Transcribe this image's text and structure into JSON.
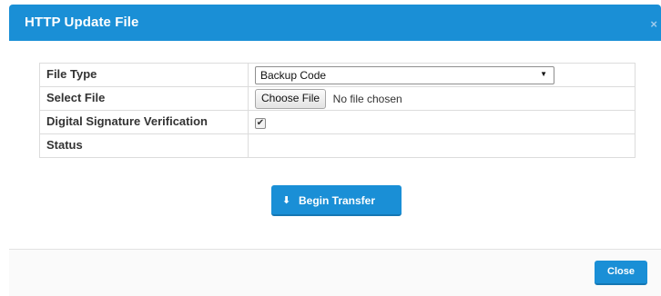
{
  "modal": {
    "title": "HTTP Update File",
    "close_glyph": "×"
  },
  "form": {
    "rows": [
      {
        "label": "File Type"
      },
      {
        "label": "Select File"
      },
      {
        "label": "Digital Signature Verification"
      },
      {
        "label": "Status"
      }
    ],
    "file_type": {
      "selected": "Backup Code",
      "arrow": "▼"
    },
    "select_file": {
      "button_label": "Choose File",
      "status": "No file chosen"
    },
    "signature_verification": {
      "checked": true,
      "check_glyph": "✔"
    },
    "status_value": ""
  },
  "actions": {
    "transfer_label": "Begin Transfer",
    "transfer_icon": "download-icon",
    "transfer_icon_glyph": "⬇",
    "close_label": "Close"
  },
  "colors": {
    "primary": "#1a8fd6",
    "header_text": "#ffffff",
    "border": "#dcdcdc"
  }
}
